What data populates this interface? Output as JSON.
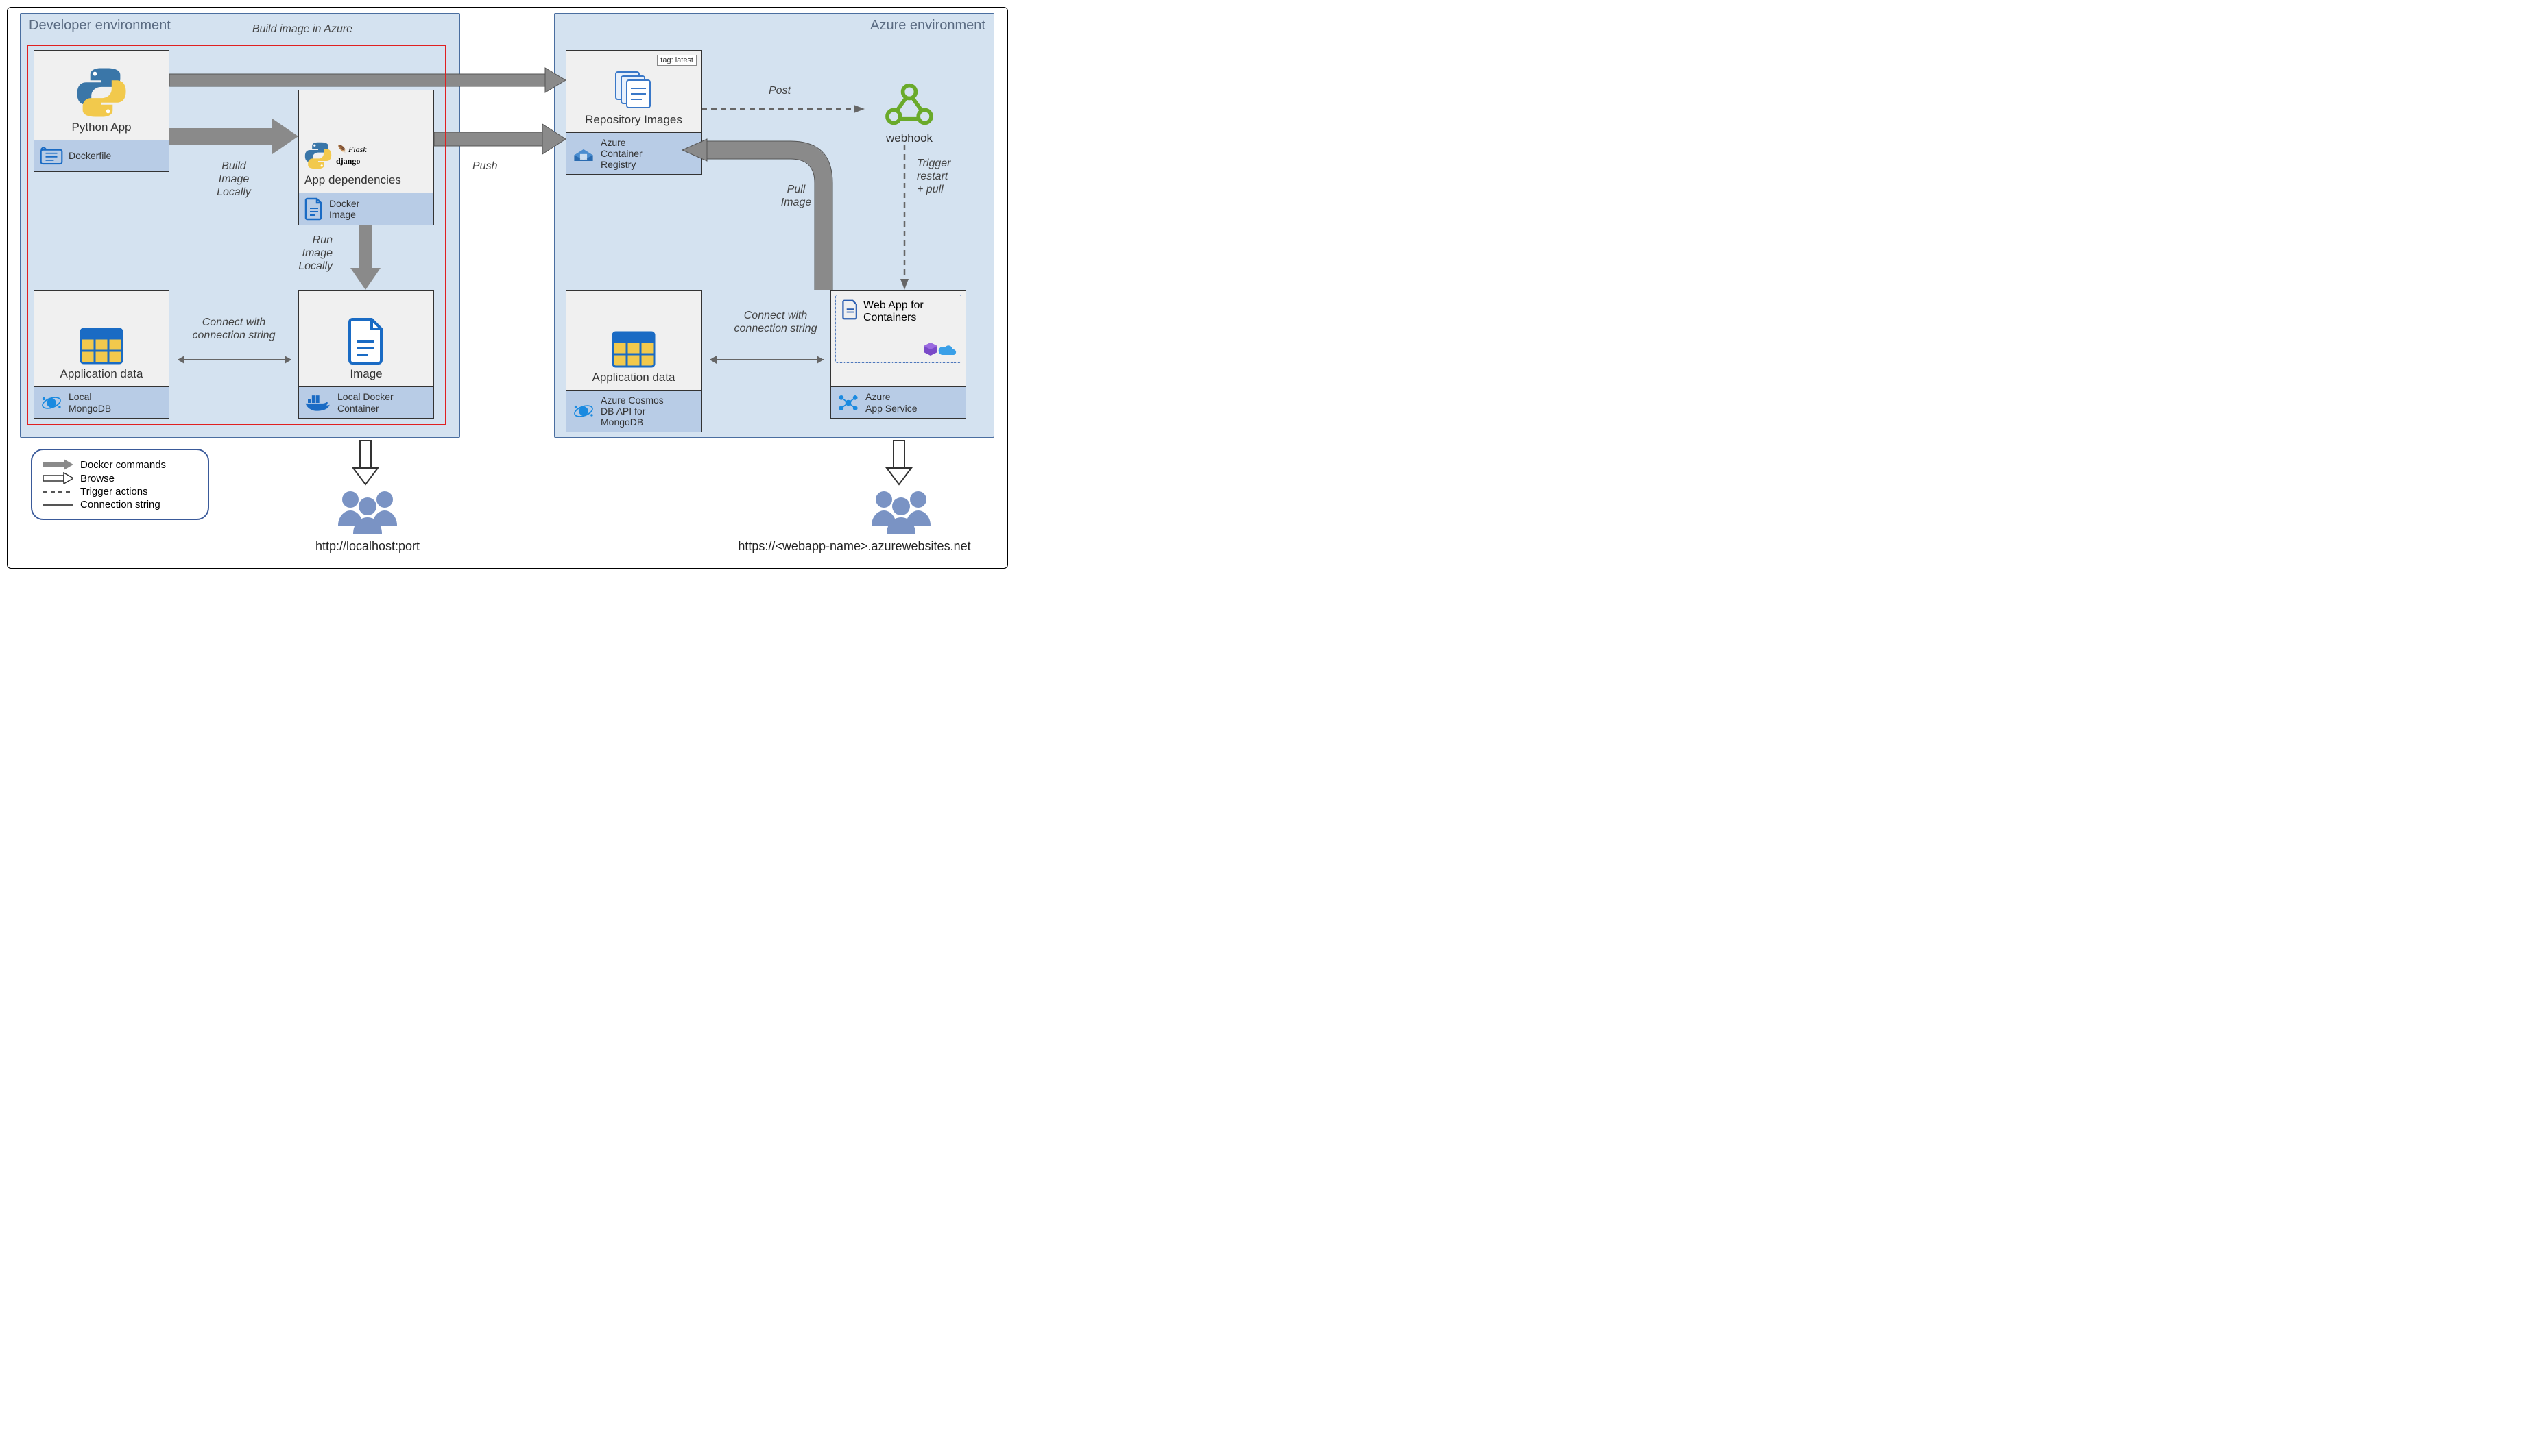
{
  "environments": {
    "dev": {
      "title": "Developer environment"
    },
    "azure": {
      "title": "Azure environment"
    }
  },
  "nodes": {
    "python_app": {
      "title": "Python App",
      "footer": "Dockerfile"
    },
    "app_deps": {
      "title": "App dependencies",
      "footer": "Docker\nImage",
      "flask": "Flask",
      "django": "django"
    },
    "image": {
      "title": "Image",
      "footer": "Local Docker\nContainer"
    },
    "app_data_local": {
      "title": "Application data",
      "footer": "Local\nMongoDB"
    },
    "repo_images": {
      "title": "Repository Images",
      "footer": "Azure\nContainer\nRegistry",
      "tag": "tag: latest"
    },
    "webhook": {
      "title": "webhook"
    },
    "app_data_azure": {
      "title": "Application data",
      "footer": "Azure Cosmos\nDB API for\nMongoDB"
    },
    "webapp": {
      "title": "Web App for\nContainers",
      "footer": "Azure\nApp Service"
    }
  },
  "labels": {
    "build_azure": "Build image in Azure",
    "build_local": "Build\nImage\nLocally",
    "run_local": "Run\nImage\nLocally",
    "push": "Push",
    "post": "Post",
    "pull_image": "Pull\nImage",
    "trigger": "Trigger\nrestart\n+ pull",
    "connect_local": "Connect with\nconnection string",
    "connect_azure": "Connect with\nconnection string"
  },
  "legend": {
    "docker_cmds": "Docker commands",
    "browse": "Browse",
    "trigger_actions": "Trigger actions",
    "conn_string": "Connection string"
  },
  "urls": {
    "local": "http://localhost:port",
    "azure": "https://<webapp-name>.azurewebsites.net"
  }
}
